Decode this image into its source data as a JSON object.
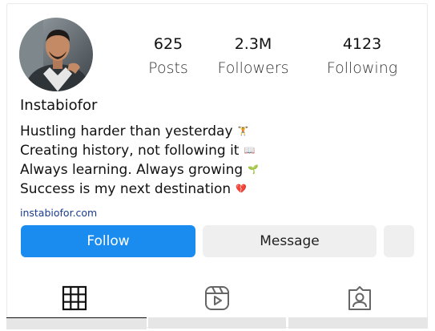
{
  "profile": {
    "username": "Instabiofor",
    "stats": [
      {
        "value": "625",
        "label": "Posts"
      },
      {
        "value": "2.3M",
        "label": "Followers"
      },
      {
        "value": "4123",
        "label": "Following"
      }
    ],
    "bio": [
      {
        "text": "Hustling harder than yesterday",
        "emoji": "🏋"
      },
      {
        "text": "Creating history, not following it",
        "emoji": "📖"
      },
      {
        "text": "Always learning. Always growing",
        "emoji": "🌱"
      },
      {
        "text": "Success is my next destination",
        "emoji": "💔"
      }
    ],
    "link": "instabiofor.com"
  },
  "actions": {
    "follow_label": "Follow",
    "message_label": "Message"
  },
  "tabs": [
    {
      "name": "grid",
      "icon": "grid-icon",
      "active": true
    },
    {
      "name": "reels",
      "icon": "reels-icon",
      "active": false
    },
    {
      "name": "tagged",
      "icon": "tagged-user-icon",
      "active": false
    }
  ],
  "colors": {
    "accent": "#1a8cf0",
    "link": "#1a3c8c",
    "button_secondary": "#efefef"
  }
}
